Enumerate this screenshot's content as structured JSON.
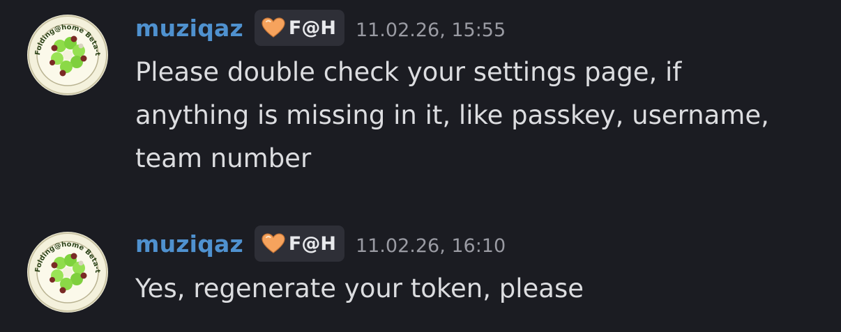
{
  "messages": [
    {
      "username": "muziqaz",
      "tag": "F@H",
      "timestamp": "11.02.26, 15:55",
      "lines": [
        "Please double check your settings page, if",
        "anything is missing in it, like passkey, username,",
        "team number"
      ],
      "avatar_text": "Folding@home Beta-tester"
    },
    {
      "username": "muziqaz",
      "tag": "F@H",
      "timestamp": "11.02.26, 16:10",
      "lines": [
        "Yes, regenerate your token, please"
      ],
      "avatar_text": "Folding@home Beta-tester"
    }
  ],
  "icons": {
    "tag_icon": "orange-heart-icon",
    "avatar": "folding-at-home-beta-tester-badge"
  },
  "colors": {
    "background": "#1b1c22",
    "username": "#4f91cf",
    "text": "#dcdde0",
    "timestamp": "#9a9ba3",
    "tag_bg": "#2e2f37",
    "heart": "#f5a15c"
  }
}
